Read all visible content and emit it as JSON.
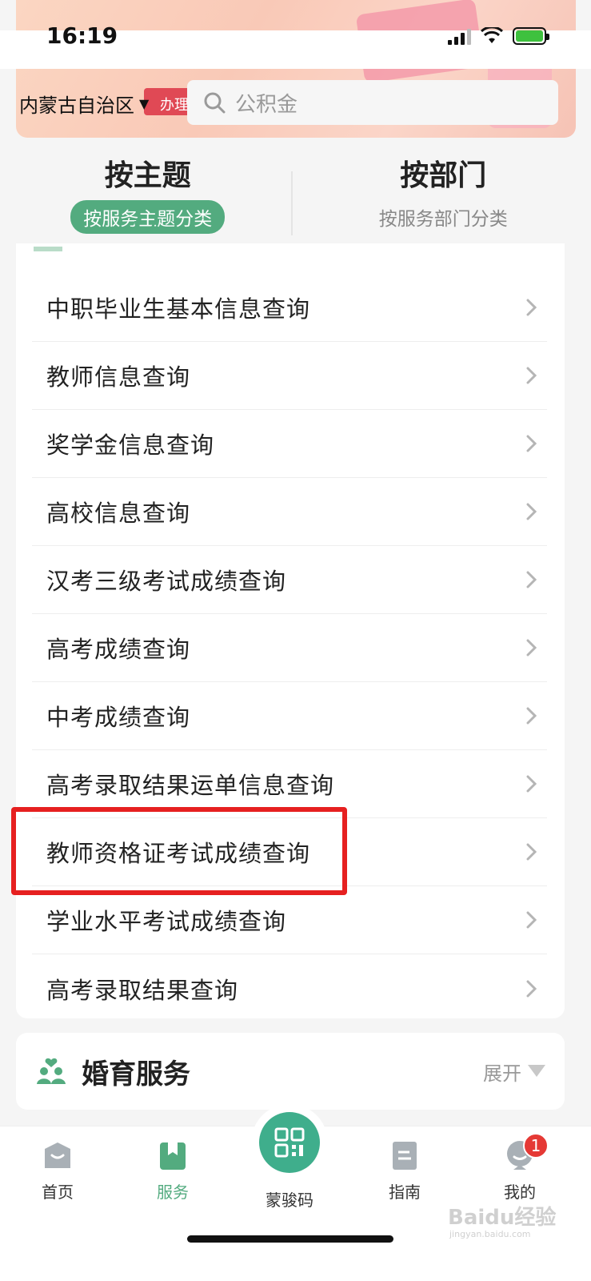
{
  "status_bar": {
    "time": "16:19"
  },
  "banner": {
    "deco_text": "办理"
  },
  "header": {
    "region": "内蒙古自治区",
    "search_placeholder": "公积金"
  },
  "tabs": [
    {
      "title": "按主题",
      "subtitle": "按服务主题分类",
      "active": true
    },
    {
      "title": "按部门",
      "subtitle": "按服务部门分类",
      "active": false
    }
  ],
  "list_items": [
    "中职毕业生基本信息查询",
    "教师信息查询",
    "奖学金信息查询",
    "高校信息查询",
    "汉考三级考试成绩查询",
    "高考成绩查询",
    "中考成绩查询",
    "高考录取结果运单信息查询",
    "教师资格证考试成绩查询",
    "学业水平考试成绩查询",
    "高考录取结果查询"
  ],
  "highlighted_item": "教师资格证考试成绩查询",
  "section": {
    "title": "婚育服务",
    "expand_label": "展开"
  },
  "bottom_nav": [
    {
      "label": "首页",
      "icon": "home-icon"
    },
    {
      "label": "服务",
      "icon": "bookmark-icon",
      "active": true
    },
    {
      "label": "蒙骏码",
      "icon": "qr-code-icon"
    },
    {
      "label": "指南",
      "icon": "guide-icon"
    },
    {
      "label": "我的",
      "icon": "profile-icon",
      "badge": "1"
    }
  ],
  "watermark": {
    "main": "Baidu经验",
    "sub": "jingyan.baidu.com"
  },
  "colors": {
    "accent": "#53ab7f",
    "highlight": "#e62020",
    "badge": "#e53935"
  }
}
